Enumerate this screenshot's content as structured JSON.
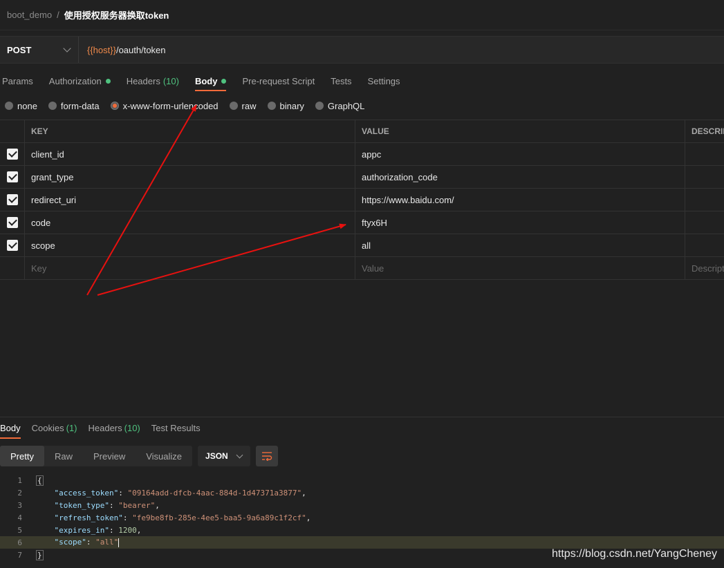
{
  "breadcrumb": {
    "parent": "boot_demo",
    "separator": "/",
    "current": "使用授权服务器换取token"
  },
  "request": {
    "method": "POST",
    "url_var": "{{host}}",
    "url_path": "/oauth/token"
  },
  "request_tabs": [
    {
      "label": "Params"
    },
    {
      "label": "Authorization",
      "dot": true
    },
    {
      "label": "Headers",
      "count": "(10)"
    },
    {
      "label": "Body",
      "dot": true,
      "active": true
    },
    {
      "label": "Pre-request Script"
    },
    {
      "label": "Tests"
    },
    {
      "label": "Settings"
    }
  ],
  "body_types": [
    {
      "label": "none",
      "checked": false
    },
    {
      "label": "form-data",
      "checked": false
    },
    {
      "label": "x-www-form-urlencoded",
      "checked": true
    },
    {
      "label": "raw",
      "checked": false
    },
    {
      "label": "binary",
      "checked": false
    },
    {
      "label": "GraphQL",
      "checked": false
    }
  ],
  "params_table": {
    "headers": {
      "key": "KEY",
      "value": "VALUE",
      "description": "DESCRIPTION"
    },
    "rows": [
      {
        "key": "client_id",
        "value": "appc",
        "checked": true
      },
      {
        "key": "grant_type",
        "value": "authorization_code",
        "checked": true
      },
      {
        "key": "redirect_uri",
        "value": "https://www.baidu.com/",
        "checked": true
      },
      {
        "key": "code",
        "value": "ftyx6H",
        "checked": true
      },
      {
        "key": "scope",
        "value": "all",
        "checked": true
      }
    ],
    "placeholders": {
      "key": "Key",
      "value": "Value",
      "description": "Description"
    }
  },
  "annotation_color": "#e8110f",
  "response_tabs": [
    {
      "label": "Body",
      "active": true
    },
    {
      "label": "Cookies",
      "count": "(1)"
    },
    {
      "label": "Headers",
      "count": "(10)"
    },
    {
      "label": "Test Results"
    }
  ],
  "response_views": [
    {
      "label": "Pretty",
      "active": true
    },
    {
      "label": "Raw"
    },
    {
      "label": "Preview"
    },
    {
      "label": "Visualize"
    }
  ],
  "response_format": "JSON",
  "wrap_icon": "text-wrap-icon",
  "response_body": {
    "line_numbers": [
      "1",
      "2",
      "3",
      "4",
      "5",
      "6",
      "7"
    ],
    "open_brace": "{",
    "close_brace": "}",
    "fields": [
      {
        "key": "\"access_token\"",
        "value": "\"09164add-dfcb-4aac-884d-1d47371a3877\"",
        "type": "str",
        "comma": ","
      },
      {
        "key": "\"token_type\"",
        "value": "\"bearer\"",
        "type": "str",
        "comma": ","
      },
      {
        "key": "\"refresh_token\"",
        "value": "\"fe9be8fb-285e-4ee5-baa5-9a6a89c1f2cf\"",
        "type": "str",
        "comma": ","
      },
      {
        "key": "\"expires_in\"",
        "value": "1200",
        "type": "num",
        "comma": ","
      },
      {
        "key": "\"scope\"",
        "value": "\"all\"",
        "type": "str",
        "comma": ""
      }
    ]
  },
  "watermark": "https://blog.csdn.net/YangCheney"
}
